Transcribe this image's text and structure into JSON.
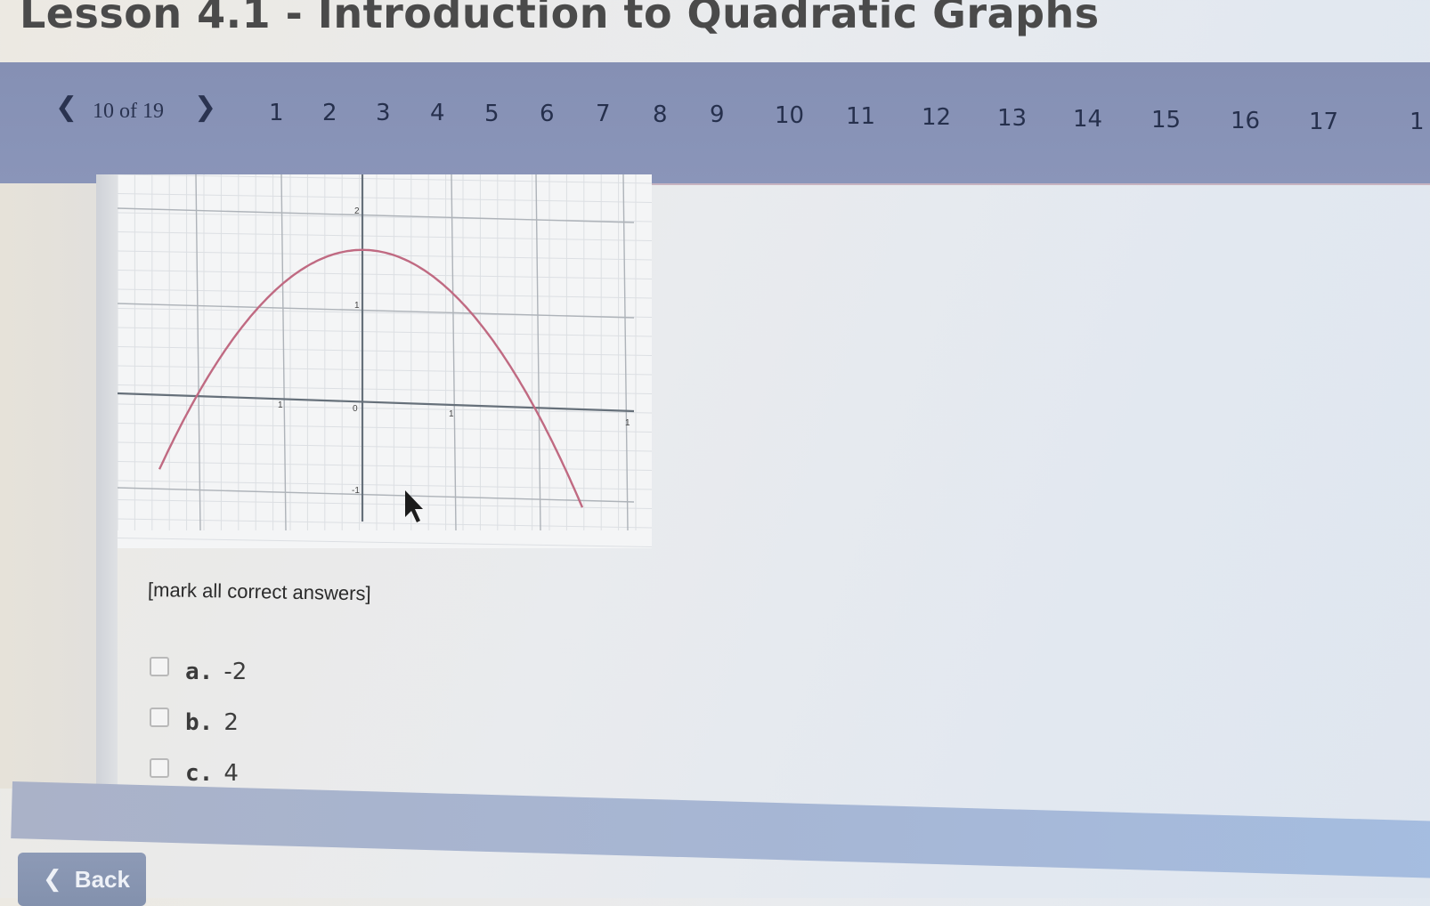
{
  "page": {
    "title": "Lesson 4.1 - Introduction to Quadratic Graphs"
  },
  "nav": {
    "counter": "10 of 19",
    "prev_icon": "chevron-left-icon",
    "next_icon": "chevron-right-icon",
    "questions": [
      "1",
      "2",
      "3",
      "4",
      "5",
      "6",
      "7",
      "8",
      "9",
      "10",
      "11",
      "12",
      "13",
      "14",
      "15",
      "16",
      "17",
      "1"
    ]
  },
  "question": {
    "instructions": "[mark all correct answers]",
    "options": [
      {
        "letter": "a.",
        "value": "-2"
      },
      {
        "letter": "b.",
        "value": "2"
      },
      {
        "letter": "c.",
        "value": "4"
      }
    ]
  },
  "graph": {
    "tick_labels": [
      "2",
      "1",
      "0",
      "1",
      "1",
      "-1",
      "1"
    ],
    "curve_color": "#c06a82",
    "x_range": [
      -2,
      3
    ],
    "y_range": [
      -1.2,
      2.3
    ]
  },
  "footer": {
    "back_label": "Back",
    "back_icon": "chevron-left-icon"
  }
}
